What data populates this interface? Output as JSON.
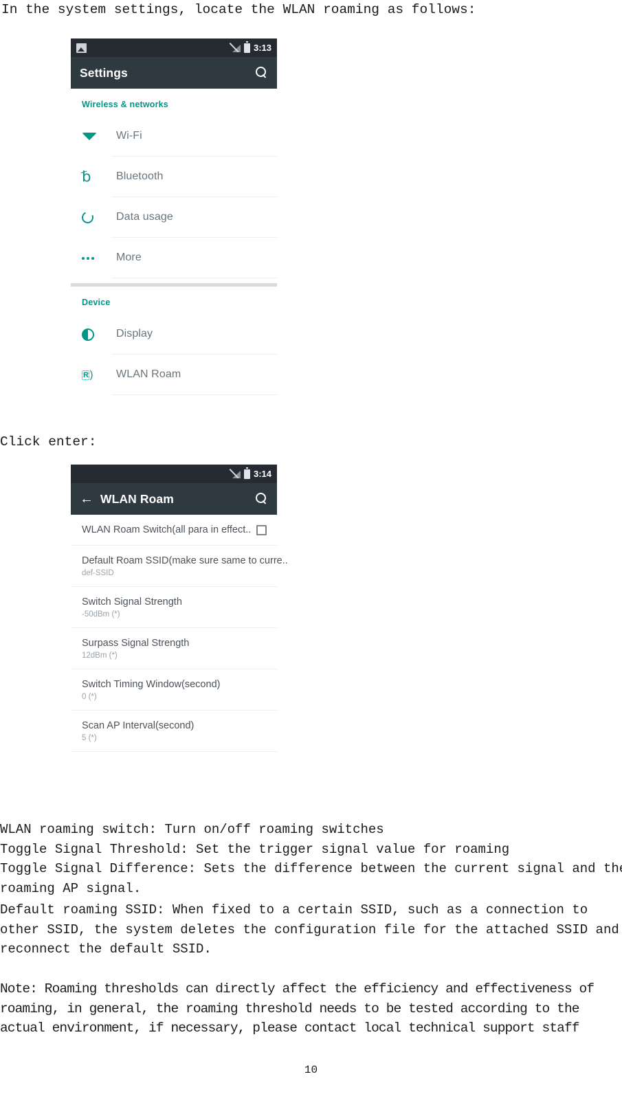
{
  "document": {
    "intro_line": "In the system settings, locate the WLAN roaming as follows:",
    "click_line": "Click enter:",
    "page_number": "10"
  },
  "settings_screenshot": {
    "status_bar": {
      "left_icon": "photo-icon",
      "signal_icon": "signal-off-icon",
      "battery_icon": "battery-icon",
      "clock": "3:13"
    },
    "app_bar": {
      "title": "Settings",
      "search_icon": "search-icon"
    },
    "sections": [
      {
        "header": "Wireless & networks",
        "items": [
          {
            "label": "Wi-Fi",
            "icon": "wifi-icon"
          },
          {
            "label": "Bluetooth",
            "icon": "bluetooth-icon"
          },
          {
            "label": "Data usage",
            "icon": "data-usage-icon"
          },
          {
            "label": "More",
            "icon": "more-icon"
          }
        ]
      },
      {
        "header": "Device",
        "items": [
          {
            "label": "Display",
            "icon": "display-icon"
          },
          {
            "label": "WLAN Roam",
            "icon": "wlan-roam-icon"
          }
        ]
      }
    ]
  },
  "wlan_roam_screenshot": {
    "status_bar": {
      "signal_icon": "signal-off-icon",
      "battery_icon": "battery-icon",
      "clock": "3:14"
    },
    "app_bar": {
      "back_icon": "arrow-left-icon",
      "title": "WLAN Roam",
      "search_icon": "search-icon"
    },
    "preferences": [
      {
        "title": "WLAN Roam Switch(all para in effect..",
        "summary": "",
        "control": "checkbox",
        "checked": false
      },
      {
        "title": "Default Roam SSID(make sure same to curre..",
        "summary": "def-SSID",
        "control": "none"
      },
      {
        "title": "Switch Signal Strength",
        "summary": "-50dBm (*)",
        "control": "none"
      },
      {
        "title": "Surpass Signal Strength",
        "summary": "12dBm (*)",
        "control": "none"
      },
      {
        "title": "Switch Timing Window(second)",
        "summary": "0 (*)",
        "control": "none"
      },
      {
        "title": "Scan AP Interval(second)",
        "summary": "5 (*)",
        "control": "none"
      }
    ]
  },
  "explanations": {
    "line1": "WLAN roaming switch: Turn on/off roaming switches",
    "line2": "Toggle Signal Threshold: Set the trigger signal value for roaming",
    "line3": "Toggle Signal Difference: Sets the difference between the current signal and the",
    "line4": "roaming AP signal.",
    "ssid_line1": "Default roaming SSID: When fixed to a certain SSID, such as a connection to",
    "ssid_line2": "other SSID, the system deletes the configuration file for the attached SSID and",
    "ssid_line3": "reconnect the default SSID.",
    "note_line1": "Note: Roaming thresholds can directly affect the efficiency and effectiveness of",
    "note_line2": "roaming, in general, the roaming threshold needs to be tested according to the",
    "note_line3": "actual environment, if necessary, please contact local technical support staff"
  },
  "colors": {
    "accent_teal": "#009688",
    "status_bar": "#252b30",
    "app_bar": "#2f3940"
  }
}
